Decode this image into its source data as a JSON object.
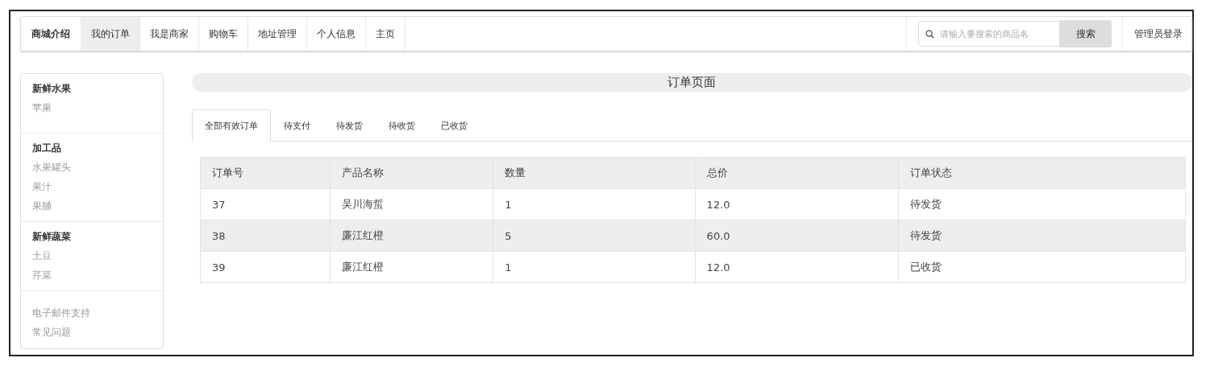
{
  "navbar": {
    "brand": "商城介绍",
    "items": [
      {
        "label": "我的订单",
        "selected": true
      },
      {
        "label": "我是商家",
        "selected": false
      },
      {
        "label": "购物车",
        "selected": false
      },
      {
        "label": "地址管理",
        "selected": false
      },
      {
        "label": "个人信息",
        "selected": false
      },
      {
        "label": "主页",
        "selected": false
      }
    ],
    "search": {
      "placeholder": "请输入要搜索的商品名",
      "button": "搜索"
    },
    "login": "管理员登录"
  },
  "sidebar": {
    "groups": [
      {
        "title": "新鲜水果",
        "items": [
          "苹果"
        ]
      },
      {
        "title": "加工品",
        "items": [
          "水果罐头",
          "果汁",
          "果脯"
        ]
      },
      {
        "title": "新鲜蔬菜",
        "items": [
          "土豆",
          "芹菜"
        ]
      },
      {
        "items": [
          "电子邮件支持",
          "常见问题"
        ]
      }
    ]
  },
  "page_title": "订单页面",
  "tabs": [
    {
      "label": "全部有效订单",
      "selected": true
    },
    {
      "label": "待支付",
      "selected": false
    },
    {
      "label": "待发货",
      "selected": false
    },
    {
      "label": "待收货",
      "selected": false
    },
    {
      "label": "已收货",
      "selected": false
    }
  ],
  "table": {
    "columns": [
      "订单号",
      "产品名称",
      "数量",
      "总价",
      "订单状态"
    ],
    "rows": [
      {
        "cells": [
          "37",
          "吴川海蜇",
          "1",
          "12.0",
          "待发货"
        ],
        "highlighted": false
      },
      {
        "cells": [
          "38",
          "廉江红橙",
          "5",
          "60.0",
          "待发货"
        ],
        "highlighted": true
      },
      {
        "cells": [
          "39",
          "廉江红橙",
          "1",
          "12.0",
          "已收货"
        ],
        "highlighted": false
      }
    ]
  }
}
